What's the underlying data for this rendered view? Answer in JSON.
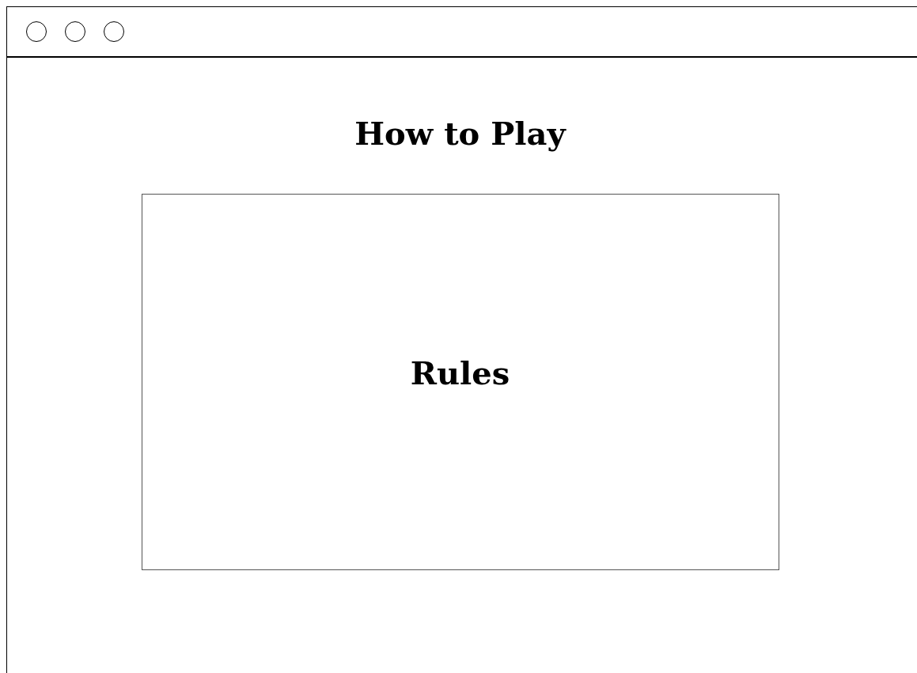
{
  "page": {
    "title": "How to Play"
  },
  "rules_panel": {
    "heading": "Rules"
  }
}
